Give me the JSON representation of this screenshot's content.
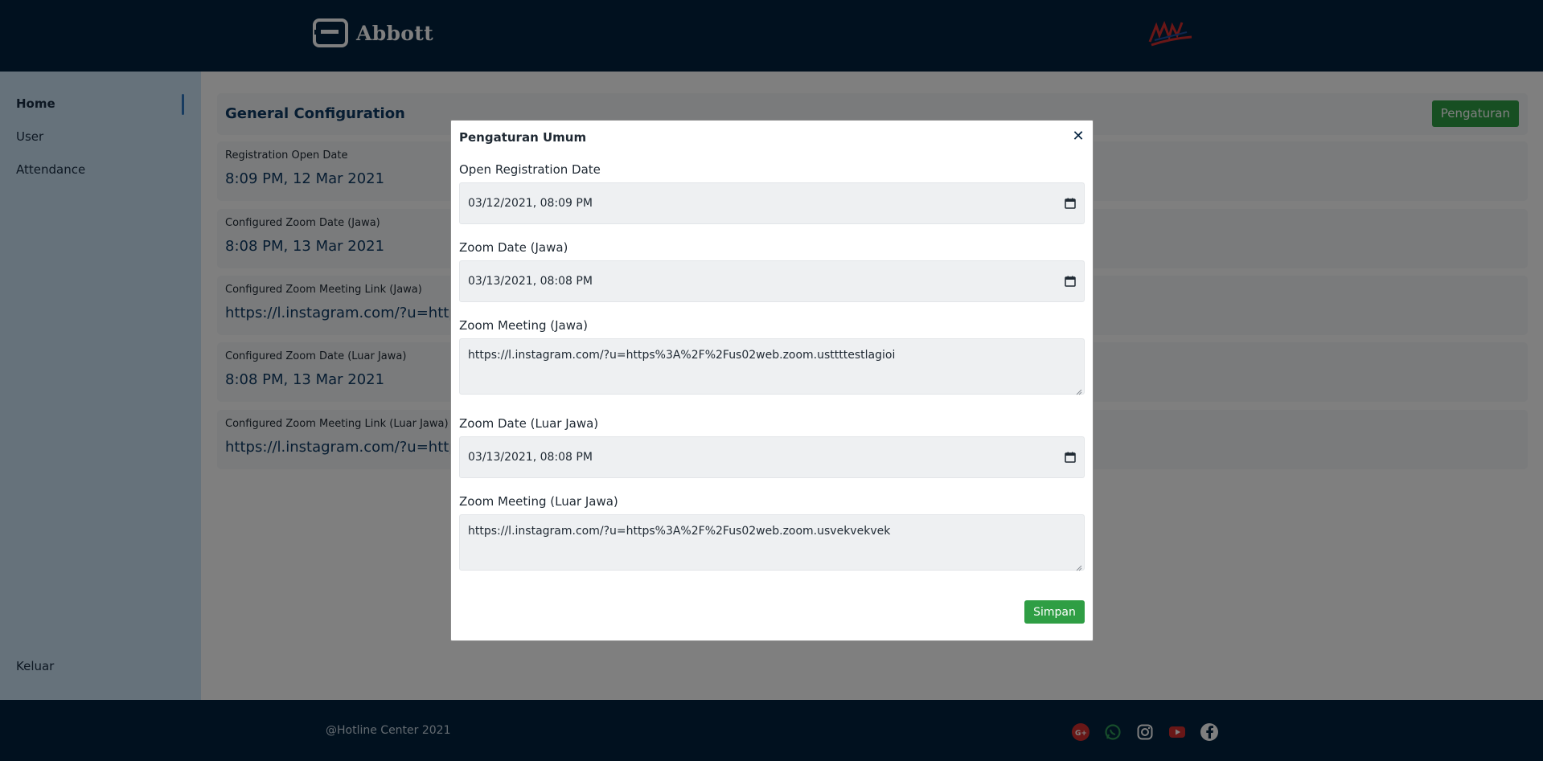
{
  "header": {
    "brand_name": "Abbott",
    "right_logo": "AAM"
  },
  "sidebar": {
    "items": [
      {
        "label": "Home"
      },
      {
        "label": "User"
      },
      {
        "label": "Attendance"
      }
    ],
    "logout_label": "Keluar"
  },
  "main": {
    "title": "General Configuration",
    "settings_button": "Pengaturan",
    "cards": [
      {
        "label": "Registration Open Date",
        "value": "8:09 PM, 12 Mar 2021"
      },
      {
        "label": "Configured Zoom Date (Jawa)",
        "value": "8:08 PM, 13 Mar 2021"
      },
      {
        "label": "Configured Zoom Meeting Link (Jawa)",
        "value": "https://l.instagram.com/?u=https"
      },
      {
        "label": "Configured Zoom Date (Luar Jawa)",
        "value": "8:08 PM, 13 Mar 2021"
      },
      {
        "label": "Configured Zoom Meeting Link (Luar Jawa)",
        "value": "https://l.instagram.com/?u=https"
      }
    ]
  },
  "footer": {
    "copyright": "@Hotline Center 2021",
    "social_icons": [
      "gplus-icon",
      "whatsapp-icon",
      "instagram-icon",
      "youtube-icon",
      "facebook-icon"
    ]
  },
  "modal": {
    "title": "Pengaturan Umum",
    "fields": [
      {
        "label": "Open Registration Date",
        "value": "03/12/2021, 08:09 PM"
      },
      {
        "label": "Zoom Date (Jawa)",
        "value": "03/13/2021, 08:08 PM"
      },
      {
        "label": "Zoom Meeting (Jawa)",
        "value": "https://l.instagram.com/?u=https%3A%2F%2Fus02web.zoom.usttttestlagioi"
      },
      {
        "label": "Zoom Date (Luar Jawa)",
        "value": "03/13/2021, 08:08 PM"
      },
      {
        "label": "Zoom Meeting (Luar Jawa)",
        "value": "https://l.instagram.com/?u=https%3A%2F%2Fus02web.zoom.usvekvekvek"
      }
    ],
    "save_button": "Simpan"
  },
  "colors": {
    "navy": "#03223f",
    "sidebar_bg": "#cde5f7",
    "accent_green": "#2f9e44",
    "value_blue": "#0f3a64"
  }
}
